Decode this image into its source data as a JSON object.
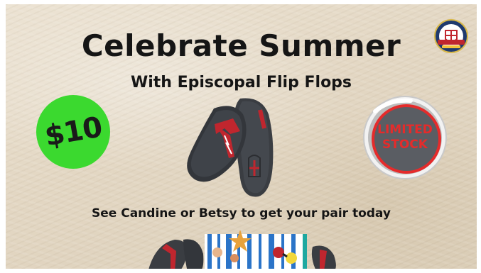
{
  "flyer": {
    "title": "Celebrate Summer",
    "subtitle": "With Episcopal Flip Flops",
    "price": "$10",
    "limited_stock": "LIMITED STOCK",
    "tagline": "See Candine or Betsy  to get your pair today"
  },
  "colors": {
    "background_sand": "#e3d7c3",
    "price_badge": "#3bd92f",
    "limited_text": "#e52b2b",
    "limited_badge_fill": "#5a5d63",
    "flipflop_body": "#3a3d42",
    "flipflop_strap": "#c0262e",
    "title_text": "#151515"
  },
  "icons": {
    "logo": "episcopal-shield-icon",
    "product": "flip-flops-icon",
    "bottom": "beach-towel-scene-icon"
  }
}
